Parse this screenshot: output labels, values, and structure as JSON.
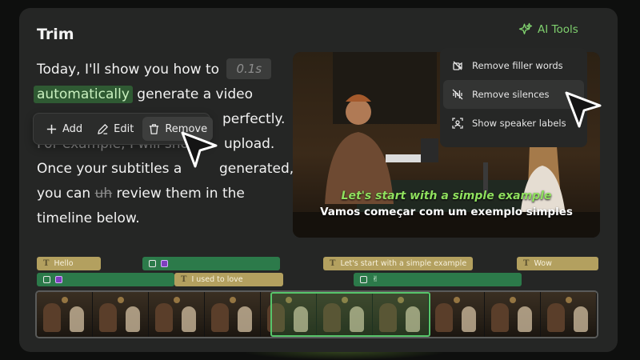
{
  "panel": {
    "title": "Trim",
    "ai_tools_label": "AI Tools"
  },
  "transcript": {
    "line1_text": "Today, I'll show you how to",
    "pause_label": "0.1s",
    "line2_highlight": "automatically",
    "line2_rest": " generate a video",
    "line3_tail": "perfectly.",
    "line4_text": "For example, I will show ",
    "line4_tail": " upload.",
    "line5_text": "Once your subtitles ",
    "line5_partial": "a",
    "line5_tail": "generated,",
    "line6_start": "you can ",
    "line6_struck": "uh",
    "line6_rest": " review them in the",
    "line7_text": "timeline below."
  },
  "toolbar": {
    "add_label": "Add",
    "edit_label": "Edit",
    "remove_label": "Remove"
  },
  "ai_menu": {
    "items": [
      {
        "label": "Remove filler words",
        "icon": "filler-words-icon"
      },
      {
        "label": "Remove silences",
        "icon": "silence-icon"
      },
      {
        "label": "Show speaker labels",
        "icon": "speaker-label-icon"
      }
    ]
  },
  "video": {
    "subtitle_primary": "Let's start with a simple example",
    "subtitle_secondary": "Vamos começar com um exemplo simples"
  },
  "timeline": {
    "row1": [
      {
        "type": "text",
        "label": "Hello"
      },
      {
        "type": "sticker",
        "label": ""
      },
      {
        "type": "text",
        "label": "Let's start with a simple example"
      },
      {
        "type": "text",
        "label": "Wow"
      }
    ],
    "row2": [
      {
        "type": "sticker",
        "label": ""
      },
      {
        "type": "text",
        "label": "I used to love"
      },
      {
        "type": "sticker",
        "label": "✌"
      }
    ]
  },
  "colors": {
    "accent_green": "#7fd06e",
    "highlight_bg": "#2f5a33",
    "text_clip": "#b3a05f",
    "sticker_clip": "#2c7a4a",
    "panel_bg": "#252625"
  }
}
